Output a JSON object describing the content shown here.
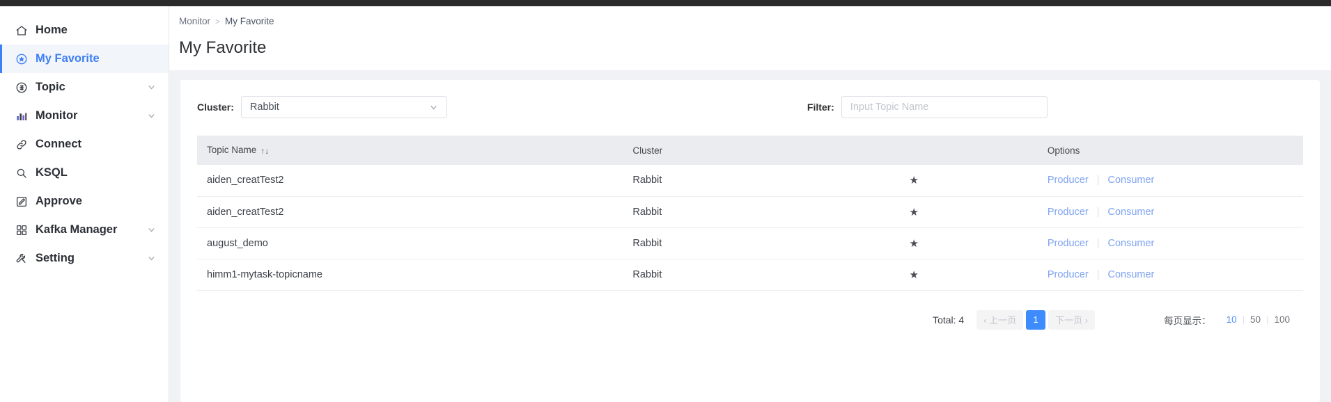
{
  "theme": {
    "accent": "#3d7ff5",
    "link": "#7ea2f3",
    "pager_active_bg": "#3d8bfd",
    "content_bg": "#f0f2f5",
    "table_head_bg": "#eaecef",
    "topbar": "#2b2b2b"
  },
  "sidebar": {
    "items": [
      {
        "label": "Home",
        "icon": "home-icon",
        "active": false,
        "caret": false
      },
      {
        "label": "My Favorite",
        "icon": "favorite-star-icon",
        "active": true,
        "caret": false
      },
      {
        "label": "Topic",
        "icon": "topic-icon",
        "active": false,
        "caret": true
      },
      {
        "label": "Monitor",
        "icon": "chart-bars-icon",
        "active": false,
        "caret": true
      },
      {
        "label": "Connect",
        "icon": "link-icon",
        "active": false,
        "caret": false
      },
      {
        "label": "KSQL",
        "icon": "search-icon",
        "active": false,
        "caret": false
      },
      {
        "label": "Approve",
        "icon": "edit-square-icon",
        "active": false,
        "caret": false
      },
      {
        "label": "Kafka Manager",
        "icon": "grid-icon",
        "active": false,
        "caret": true
      },
      {
        "label": "Setting",
        "icon": "tools-icon",
        "active": false,
        "caret": true
      }
    ]
  },
  "breadcrumb": {
    "parent": "Monitor",
    "separator": ">",
    "current": "My Favorite"
  },
  "page": {
    "title": "My Favorite"
  },
  "filters": {
    "cluster_label": "Cluster:",
    "cluster_value": "Rabbit",
    "cluster_options": [
      "Rabbit"
    ],
    "filter_label": "Filter:",
    "filter_value": "",
    "filter_placeholder": "Input Topic Name"
  },
  "table": {
    "columns": [
      "Topic Name",
      "Cluster",
      "",
      "Options"
    ],
    "sort_icon": "↑↓",
    "star_icon": "★",
    "options": {
      "producer": "Producer",
      "consumer": "Consumer",
      "separator": "|"
    },
    "rows": [
      {
        "topic": "aiden_creatTest2",
        "cluster": "Rabbit",
        "favorite": true
      },
      {
        "topic": "aiden_creatTest2",
        "cluster": "Rabbit",
        "favorite": true
      },
      {
        "topic": "august_demo",
        "cluster": "Rabbit",
        "favorite": true
      },
      {
        "topic": "himm1-mytask-topicname",
        "cluster": "Rabbit",
        "favorite": true
      }
    ]
  },
  "pagination": {
    "total_label": "Total: 4",
    "prev_label": "‹ 上一页",
    "current_page": "1",
    "next_label": "下一页 ›",
    "page_size_label": "每页显示：",
    "page_sizes": [
      "10",
      "50",
      "100"
    ],
    "active_page_size": "10",
    "separator": "|"
  }
}
